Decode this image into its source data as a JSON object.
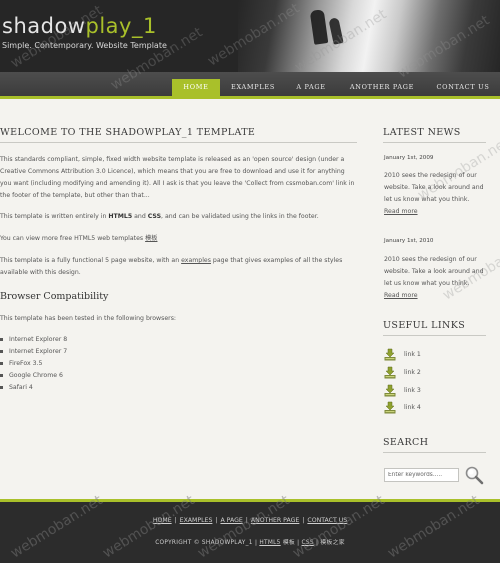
{
  "header": {
    "logo_part1": "shadow",
    "logo_part2": "play_1",
    "slogan": "Simple. Contemporary. Website Template"
  },
  "nav": {
    "items": [
      {
        "label": "HOME",
        "selected": true
      },
      {
        "label": "EXAMPLES"
      },
      {
        "label": "A PAGE"
      },
      {
        "label": "ANOTHER PAGE"
      },
      {
        "label": "CONTACT US"
      }
    ]
  },
  "content": {
    "title": "WELCOME TO THE SHADOWPLAY_1 TEMPLATE",
    "p1": "This standards compliant, simple, fixed width website template is released as an 'open source' design (under a Creative Commons Attribution 3.0 Licence), which means that you are free to download and use it for anything you want (including modifying and amending it). All I ask is that you leave the 'Collect from cssmoban.com' link in the footer of the template, but other than that...",
    "p2_pre": "This template is written entirely in ",
    "p2_html5": "HTML5",
    "p2_and": " and ",
    "p2_css": "CSS",
    "p2_post": ", and can be validated using the links in the footer.",
    "p3_pre": "You can view more free HTML5 web templates ",
    "p3_link": "模板",
    "p4_pre": "This template is a fully functional 5 page website, with an ",
    "p4_link": "examples",
    "p4_post": " page that gives examples of all the styles available with this design.",
    "compat_title": "Browser Compatibility",
    "compat_intro": "This template has been tested in the following browsers:",
    "browsers": [
      "Internet Explorer 8",
      "Internet Explorer 7",
      "FireFox 3.5",
      "Google Chrome 6",
      "Safari 4"
    ]
  },
  "sidebar": {
    "news_title": "LATEST NEWS",
    "news": [
      {
        "date": "January 1st, 2009",
        "text": "2010 sees the redesign of our website. Take a look around and let us know what you think.",
        "more": "Read more"
      },
      {
        "date": "January 1st, 2010",
        "text": "2010 sees the redesign of our website. Take a look around and let us know what you think.",
        "more": "Read more"
      }
    ],
    "links_title": "USEFUL LINKS",
    "links": [
      "link 1",
      "link 2",
      "link 3",
      "link 4"
    ],
    "search_title": "SEARCH",
    "search_placeholder": "Enter keywords....."
  },
  "footer": {
    "links": [
      "HOME",
      "EXAMPLES",
      "A PAGE",
      "ANOTHER PAGE",
      "CONTACT US"
    ],
    "copyright_pre": "COPYRIGHT © SHADOWPLAY_1 | ",
    "copyright_html5": "HTML5",
    "copyright_mid": " 模板 | ",
    "copyright_css": "CSS",
    "copyright_post": " | 模板之家"
  },
  "watermark": "webmoban.net",
  "colors": {
    "accent": "#a9c02a",
    "header_bg": "#262626",
    "footer_bg": "#2c2c2c",
    "page_bg": "#f4f3ef"
  }
}
